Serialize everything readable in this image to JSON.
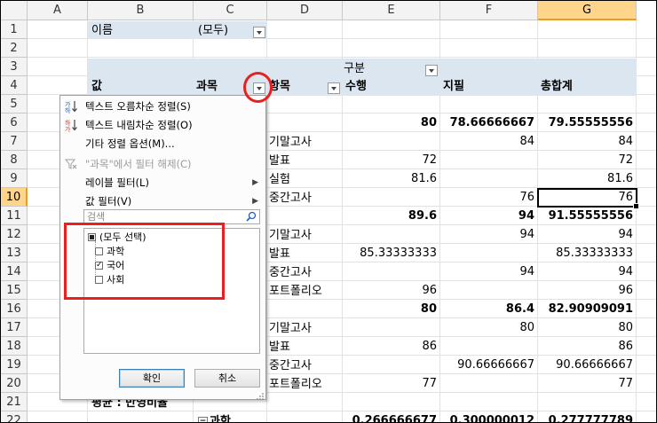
{
  "columns": [
    "A",
    "B",
    "C",
    "D",
    "E",
    "F",
    "G"
  ],
  "rows": [
    "1",
    "2",
    "3",
    "4",
    "5",
    "6",
    "7",
    "8",
    "9",
    "10",
    "11",
    "12",
    "13",
    "14",
    "15",
    "16",
    "17",
    "18",
    "19",
    "20",
    "21",
    "22"
  ],
  "pivot": {
    "filter_label": "이름",
    "filter_value": "(모두)",
    "col_field_label": "구분",
    "values_label": "값",
    "subject_label": "과목",
    "item_label": "항목",
    "col_items": [
      "수행",
      "지필",
      "총합계"
    ]
  },
  "row_labels": {
    "r7": "기말고사",
    "r8": "발표",
    "r9": "실험",
    "r10": "중간고사",
    "r12": "기말고사",
    "r13": "발표",
    "r14": "중간고사",
    "r15": "포트폴리오",
    "r17": "기말고사",
    "r18": "발표",
    "r19": "중간고사",
    "r20": "포트폴리오",
    "r21": "평균 : 반영비율",
    "r22": "과학"
  },
  "values": {
    "r6": [
      "80",
      "78.66666667",
      "79.55555556"
    ],
    "r7": [
      "",
      "84",
      "84"
    ],
    "r8": [
      "72",
      "",
      "72"
    ],
    "r9": [
      "81.6",
      "",
      "81.6"
    ],
    "r10": [
      "",
      "76",
      "76"
    ],
    "r11": [
      "89.6",
      "94",
      "91.55555556"
    ],
    "r12": [
      "",
      "94",
      "94"
    ],
    "r13": [
      "85.33333333",
      "",
      "85.33333333"
    ],
    "r14": [
      "",
      "94",
      "94"
    ],
    "r15": [
      "96",
      "",
      "96"
    ],
    "r16": [
      "80",
      "86.4",
      "82.90909091"
    ],
    "r17": [
      "",
      "80",
      "80"
    ],
    "r18": [
      "86",
      "",
      "86"
    ],
    "r19": [
      "",
      "90.66666667",
      "90.66666667"
    ],
    "r20": [
      "77",
      "",
      "77"
    ],
    "r22": [
      "0.266666677",
      "0.300000012",
      "0.277777789"
    ]
  },
  "filter_menu": {
    "sort_asc": "텍스트 오름차순 정렬(S)",
    "sort_desc": "텍스트 내림차순 정렬(O)",
    "more_sort": "기타 정렬 옵션(M)...",
    "clear_filter": "\"과목\"에서 필터 해제(C)",
    "label_filter": "레이블 필터(L)",
    "value_filter": "값 필터(V)",
    "search_placeholder": "검색",
    "items": [
      {
        "label": "(모두 선택)",
        "state": "indeterminate"
      },
      {
        "label": "과학",
        "state": "unchecked"
      },
      {
        "label": "국어",
        "state": "checked"
      },
      {
        "label": "사회",
        "state": "unchecked"
      }
    ],
    "ok_label": "확인",
    "cancel_label": "취소"
  },
  "highlight_color": "#ea1f1f",
  "pivot_band_color": "#dce6f1",
  "active_cell": "G10"
}
